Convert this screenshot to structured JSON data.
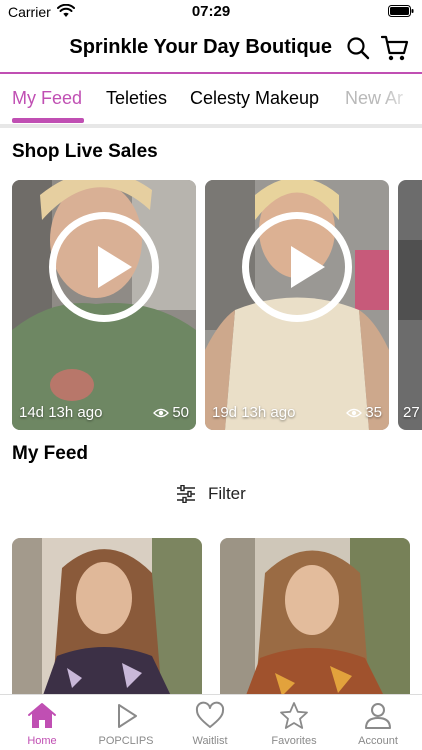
{
  "status_bar": {
    "carrier": "Carrier",
    "time": "07:29"
  },
  "header": {
    "title": "Sprinkle Your Day Boutique"
  },
  "tabs": [
    {
      "label": "My Feed",
      "active": true
    },
    {
      "label": "Teleties"
    },
    {
      "label": "Celesty Makeup"
    },
    {
      "label": "New Ar"
    }
  ],
  "live_section": {
    "title": "Shop Live Sales",
    "cards": [
      {
        "age": "14d 13h ago",
        "views": "50"
      },
      {
        "age": "19d 13h ago",
        "views": "35"
      },
      {
        "age": "27"
      }
    ]
  },
  "feed_section": {
    "title": "My Feed",
    "filter_label": "Filter"
  },
  "bottom_nav": [
    {
      "label": "Home",
      "icon": "home-icon",
      "active": true
    },
    {
      "label": "POPCLIPS",
      "icon": "play-icon"
    },
    {
      "label": "Waitlist",
      "icon": "heart-icon"
    },
    {
      "label": "Favorites",
      "icon": "star-icon"
    },
    {
      "label": "Account",
      "icon": "person-icon"
    }
  ],
  "colors": {
    "accent": "#c04fb3",
    "inactive": "#8a8a8a"
  }
}
